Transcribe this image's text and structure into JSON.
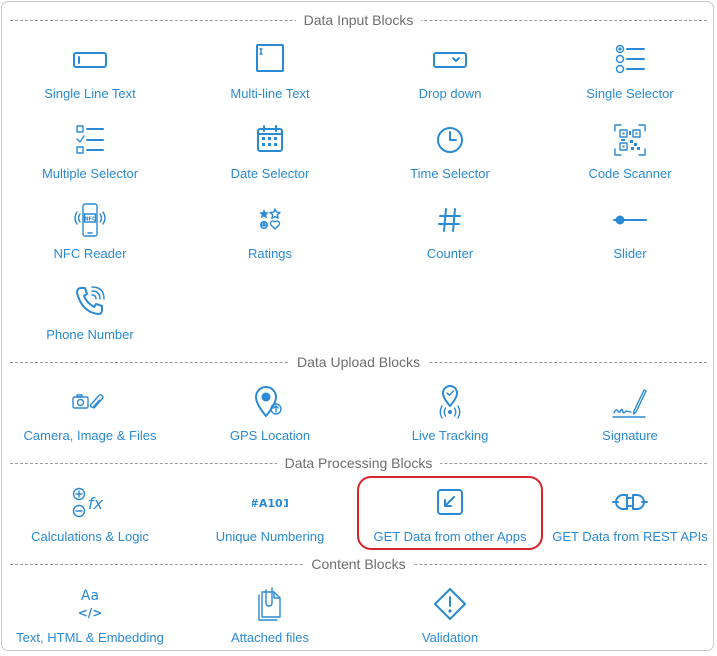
{
  "sections": {
    "input": "Data Input Blocks",
    "upload": "Data Upload Blocks",
    "processing": "Data Processing Blocks",
    "content": "Content Blocks"
  },
  "blocks": {
    "single_line_text": "Single Line Text",
    "multi_line_text": "Multi-line Text",
    "drop_down": "Drop down",
    "single_selector": "Single Selector",
    "multiple_selector": "Multiple Selector",
    "date_selector": "Date Selector",
    "time_selector": "Time Selector",
    "code_scanner": "Code Scanner",
    "nfc_reader": "NFC Reader",
    "ratings": "Ratings",
    "counter": "Counter",
    "slider": "Slider",
    "phone_number": "Phone Number",
    "camera_image_files": "Camera, Image & Files",
    "gps_location": "GPS Location",
    "live_tracking": "Live Tracking",
    "signature": "Signature",
    "calculations_logic": "Calculations & Logic",
    "unique_numbering": "Unique Numbering",
    "get_data_other_apps": "GET Data from other Apps",
    "get_data_rest_apis": "GET Data from REST APIs",
    "text_html_embedding": "Text, HTML & Embedding",
    "attached_files": "Attached files",
    "validation": "Validation"
  },
  "icon_text": {
    "nfc": "NFC",
    "unique_numbering": "#A101",
    "aa": "Aa",
    "code": "</>",
    "fx": "fx",
    "counter": "#"
  },
  "colors": {
    "accent": "#2b8ad6",
    "highlight": "#d6262b"
  }
}
